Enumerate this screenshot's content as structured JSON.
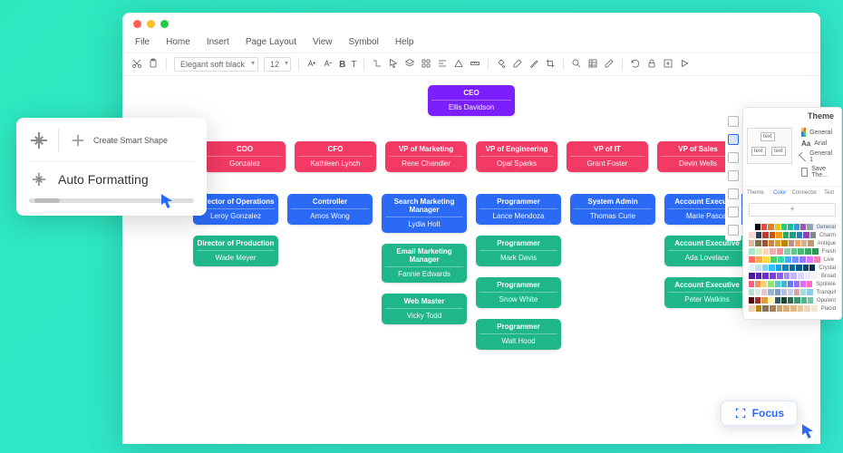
{
  "menus": [
    "File",
    "Home",
    "Insert",
    "Page Layout",
    "View",
    "Symbol",
    "Help"
  ],
  "toolbar": {
    "font": "Elegant soft black",
    "size": "12"
  },
  "org": {
    "ceo": {
      "role": "CEO",
      "name": "Ellis Davidson"
    },
    "vps": [
      {
        "role": "COO",
        "name": "Gonzalez"
      },
      {
        "role": "CFO",
        "name": "Kathleen Lynch"
      },
      {
        "role": "VP of Marketing",
        "name": "Rene Chandler"
      },
      {
        "role": "VP of Engineering",
        "name": "Opal Sparks"
      },
      {
        "role": "VP of IT",
        "name": "Grant Foster"
      },
      {
        "role": "VP of Sales",
        "name": "Devin Wells"
      }
    ],
    "cols": [
      [
        {
          "role": "Director of Operations",
          "name": "Leroy Gonzalez",
          "cls": "lvl2"
        },
        {
          "role": "Director of Production",
          "name": "Wade Meyer",
          "cls": "lvl3"
        }
      ],
      [
        {
          "role": "Controller",
          "name": "Amos Wong",
          "cls": "lvl2"
        }
      ],
      [
        {
          "role": "Search Marketing Manager",
          "name": "Lydia Holt",
          "cls": "lvl2"
        },
        {
          "role": "Email Marketing Manager",
          "name": "Fannie Edwards",
          "cls": "lvl3"
        },
        {
          "role": "Web Master",
          "name": "Vicky Todd",
          "cls": "lvl3"
        }
      ],
      [
        {
          "role": "Programmer",
          "name": "Lance Mendoza",
          "cls": "lvl2"
        },
        {
          "role": "Programmer",
          "name": "Mark Davis",
          "cls": "lvl3"
        },
        {
          "role": "Programmer",
          "name": "Snow White",
          "cls": "lvl3"
        },
        {
          "role": "Programmer",
          "name": "Walt Hood",
          "cls": "lvl3"
        }
      ],
      [
        {
          "role": "System Admin",
          "name": "Thomas Curie",
          "cls": "lvl2"
        }
      ],
      [
        {
          "role": "Account Executive",
          "name": "Marie Pascal",
          "cls": "lvl2"
        },
        {
          "role": "Account Executive",
          "name": "Ada Lovelace",
          "cls": "lvl3"
        },
        {
          "role": "Account Executive",
          "name": "Peter Watkins",
          "cls": "lvl3"
        }
      ]
    ]
  },
  "theme": {
    "title": "Theme",
    "opts": [
      "General",
      "Arial",
      "General 1",
      "Save The..."
    ],
    "tabs": [
      "Theme",
      "Color",
      "Connector",
      "Text"
    ],
    "palettes": [
      "General",
      "Charm",
      "Antique",
      "Fresh",
      "Live",
      "Crystal",
      "Broad",
      "Sprinkle",
      "Tranquil",
      "Opulent",
      "Placid"
    ],
    "colors": [
      [
        "#fff",
        "#000",
        "#e74c3c",
        "#e67e22",
        "#f1c40f",
        "#2ecc71",
        "#1abc9c",
        "#3498db",
        "#9b59b6",
        "#95a5a6"
      ],
      [
        "#f6d5d5",
        "#2c3e50",
        "#c0392b",
        "#d35400",
        "#f39c12",
        "#27ae60",
        "#16a085",
        "#2980b9",
        "#8e44ad",
        "#7f8c8d"
      ],
      [
        "#d7bba0",
        "#8b6f47",
        "#a0522d",
        "#cd853f",
        "#daa520",
        "#b8860b",
        "#bc8f8f",
        "#f4a460",
        "#d2b48c",
        "#c19a6b"
      ],
      [
        "#a8e6cf",
        "#dcedc1",
        "#ffd3b6",
        "#ffaaa5",
        "#ff8b94",
        "#7ed6a5",
        "#5fc98f",
        "#4bb97b",
        "#3aa767",
        "#2d9556"
      ],
      [
        "#ff6b6b",
        "#ffa94d",
        "#ffd93d",
        "#51cf66",
        "#38d9a9",
        "#4dabf7",
        "#748ffc",
        "#9775fa",
        "#da77f2",
        "#f783ac"
      ],
      [
        "#e0f2fe",
        "#bae6fd",
        "#7dd3fc",
        "#38bdf8",
        "#0ea5e9",
        "#0284c7",
        "#0369a1",
        "#075985",
        "#0c4a6e",
        "#082f49"
      ],
      [
        "#4c1d95",
        "#5b21b6",
        "#6d28d9",
        "#7c3aed",
        "#8b5cf6",
        "#a78bfa",
        "#c4b5fd",
        "#ddd6fe",
        "#ede9fe",
        "#f5f3ff"
      ],
      [
        "#ff5e7e",
        "#ff8a5b",
        "#ffd56b",
        "#8de969",
        "#4ecdc4",
        "#45b7d1",
        "#5d7bf4",
        "#9b6dff",
        "#e06bff",
        "#ff6bc9"
      ],
      [
        "#b8e0d2",
        "#d6eadf",
        "#eac4d5",
        "#95b8d1",
        "#809bce",
        "#b8bedd",
        "#c7ceea",
        "#d4a5a5",
        "#a8dadc",
        "#8ecae6"
      ],
      [
        "#540b0e",
        "#9e2a2b",
        "#e09f3e",
        "#fff3b0",
        "#335c67",
        "#1b4332",
        "#2d6a4f",
        "#40916c",
        "#52b788",
        "#74c69d"
      ],
      [
        "#e8d5b7",
        "#b8860b",
        "#8b7355",
        "#a67c52",
        "#c9a66b",
        "#d4af7a",
        "#deb887",
        "#e6c79c",
        "#eed6b3",
        "#f5e6ca"
      ]
    ]
  },
  "float": {
    "smart": "Create Smart Shape",
    "auto": "Auto Formatting"
  },
  "focus": "Focus"
}
